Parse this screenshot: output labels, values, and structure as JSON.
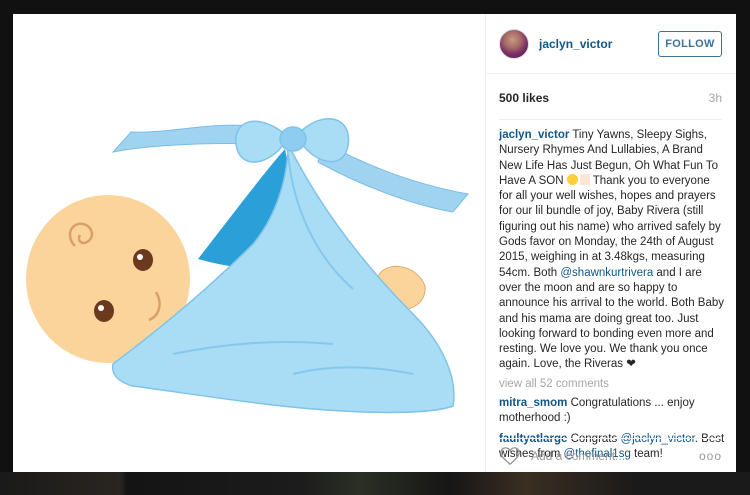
{
  "post": {
    "username": "jaclyn_victor",
    "follow_label": "FOLLOW",
    "likes": "500 likes",
    "time": "3h"
  },
  "caption": {
    "username": "jaclyn_victor",
    "text_1": " Tiny Yawns, Sleepy Sighs, Nursery Rhymes And Lullabies, A Brand New Life Has Just Begun, Oh What Fun To Have A SON ",
    "text_2": " Thank you to everyone for all your well wishes, hopes and prayers for our lil bundle of joy, Baby Rivera (still figuring out his name) who arrived safely by Gods favor on Monday, the 24th of August 2015, weighing in at 3.48kgs, measuring 54cm. Both ",
    "mention": "@shawnkurtrivera",
    "text_3": " and I are over the moon and are so happy to announce his arrival to the world. Both Baby and his mama are doing great too. Just looking forward to bonding even more and resting. We love you. We thank you once again. Love, the Riveras ",
    "heart": "❤"
  },
  "view_all": "view all 52 comments",
  "comments": [
    {
      "username": "mitra_smom",
      "text": " Congratulations ... enjoy motherhood :)"
    },
    {
      "username": "faultyatlarge",
      "text_1": " Congrats ",
      "mention_1": "@jaclyn_victor",
      "text_2": ". Best wishes from ",
      "mention_2": "@thefinal1sg",
      "text_3": " team!"
    }
  ],
  "footer": {
    "placeholder": "Add a comment...",
    "more": "ooo"
  },
  "colors": {
    "link": "#125688",
    "follow": "#3f729b",
    "blanket": "#a9dcf5",
    "skin": "#fbd49b"
  },
  "icons": {
    "like": "heart-outline-icon",
    "more": "more-options-icon"
  }
}
